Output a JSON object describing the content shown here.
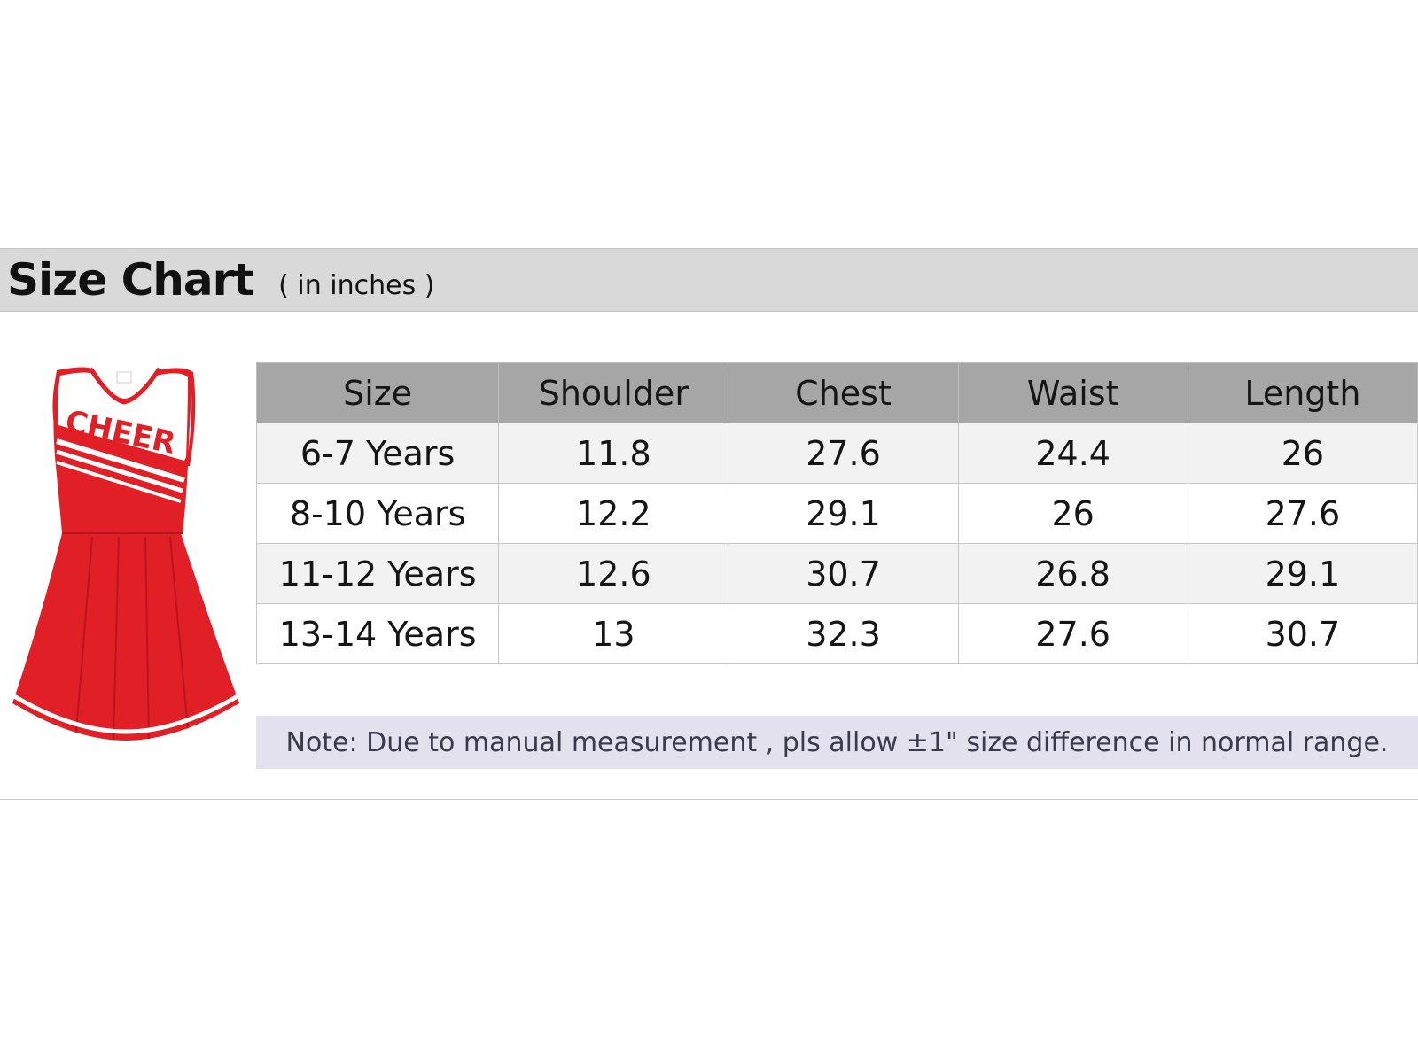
{
  "header": {
    "title": "Size Chart",
    "unit_note": "( in inches )"
  },
  "illustration": {
    "icon": "cheerleader-dress-icon",
    "print_text": "CHEER",
    "colors": {
      "dress_red": "#e01f26",
      "trim_white": "#ffffff"
    }
  },
  "table": {
    "columns": [
      "Size",
      "Shoulder",
      "Chest",
      "Waist",
      "Length"
    ],
    "rows": [
      [
        "6-7 Years",
        "11.8",
        "27.6",
        "24.4",
        "26"
      ],
      [
        "8-10 Years",
        "12.2",
        "29.1",
        "26",
        "27.6"
      ],
      [
        "11-12 Years",
        "12.6",
        "30.7",
        "26.8",
        "29.1"
      ],
      [
        "13-14 Years",
        "13",
        "32.3",
        "27.6",
        "30.7"
      ]
    ]
  },
  "note": "Note: Due to manual measurement , pls allow ±1\" size difference in normal range.",
  "colors": {
    "title_band": "#d9d9d9",
    "table_header": "#a6a6a6",
    "row_alt": "#f2f2f2",
    "note_band": "#e3e1ee"
  }
}
